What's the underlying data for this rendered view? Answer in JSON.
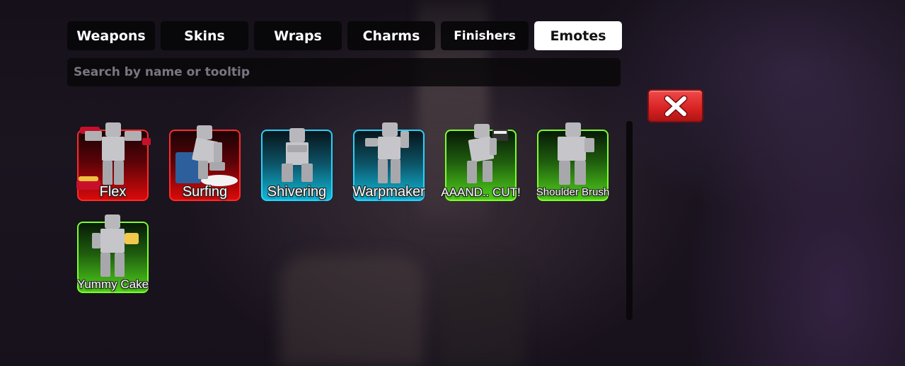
{
  "tabs": [
    {
      "label": "Weapons",
      "active": false
    },
    {
      "label": "Skins",
      "active": false
    },
    {
      "label": "Wraps",
      "active": false
    },
    {
      "label": "Charms",
      "active": false
    },
    {
      "label": "Finishers",
      "active": false
    },
    {
      "label": "Emotes",
      "active": true
    }
  ],
  "search": {
    "placeholder": "Search by name or tooltip",
    "value": ""
  },
  "close_button": {
    "icon": "close-x-icon",
    "color": "#e02c2c"
  },
  "emotes": [
    {
      "name": "Flex",
      "rarity_color": "#d90a0a"
    },
    {
      "name": "Surfing",
      "rarity_color": "#d90a0a"
    },
    {
      "name": "Shivering",
      "rarity_color": "#11b8d8"
    },
    {
      "name": "Warpmaker",
      "rarity_color": "#11b8d8"
    },
    {
      "name": "AAAND.. CUT!",
      "rarity_color": "#4fd01a"
    },
    {
      "name": "Shoulder Brush",
      "rarity_color": "#4fd01a"
    },
    {
      "name": "Yummy Cake",
      "rarity_color": "#4fd01a"
    }
  ]
}
